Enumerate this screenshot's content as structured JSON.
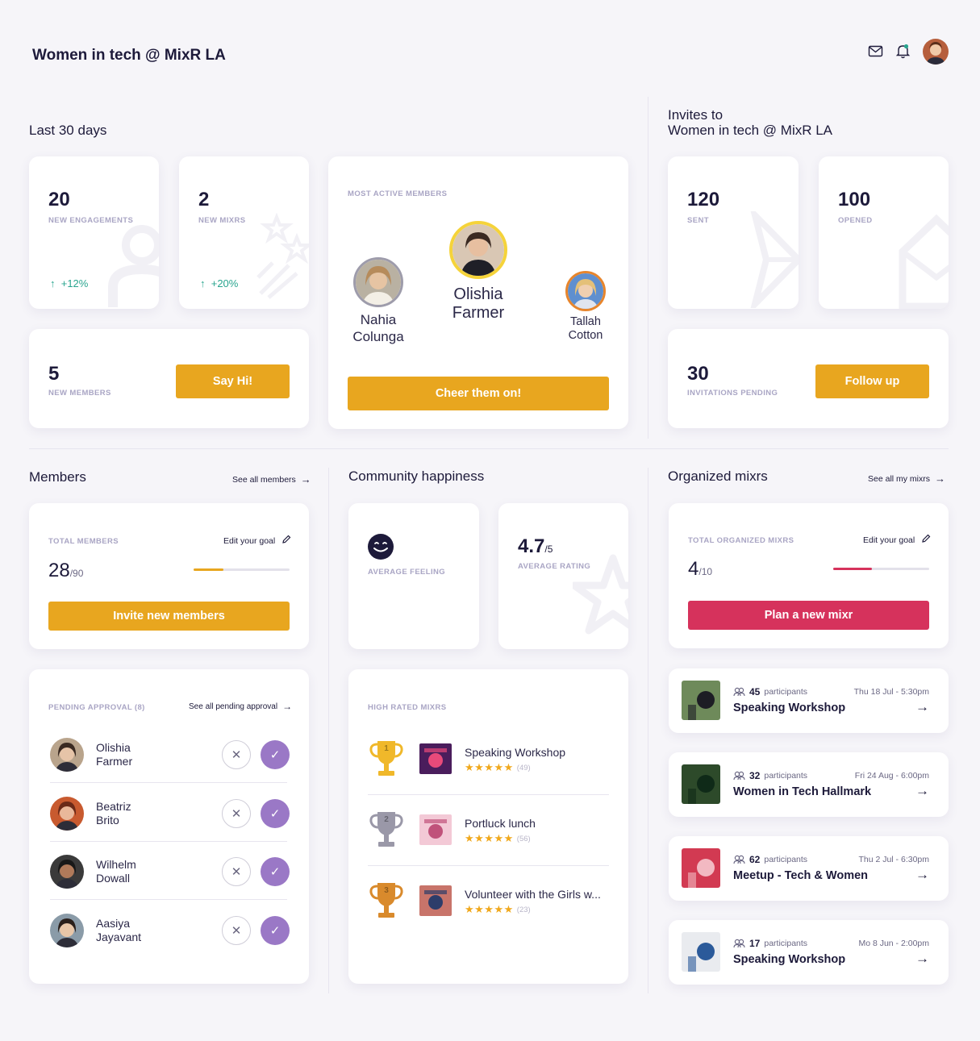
{
  "header": {
    "title": "Women in tech @ MixR LA"
  },
  "last30": {
    "title": "Last 30 days",
    "engagements": {
      "value": "20",
      "label": "NEW ENGAGEMENTS",
      "change": "+12%"
    },
    "mixrs": {
      "value": "2",
      "label": "NEW MIXRS",
      "change": "+20%"
    },
    "members": {
      "value": "5",
      "label": "NEW MEMBERS",
      "button": "Say Hi!"
    }
  },
  "active": {
    "label": "MOST ACTIVE MEMBERS",
    "first": {
      "name1": "Olishia",
      "name2": "Farmer"
    },
    "second": {
      "name1": "Nahia",
      "name2": "Colunga"
    },
    "third": {
      "name1": "Tallah",
      "name2": "Cotton"
    },
    "button": "Cheer them on!"
  },
  "invites": {
    "title1": "Invites to",
    "title2": "Women in tech @ MixR LA",
    "sent": {
      "value": "120",
      "label": "SENT"
    },
    "opened": {
      "value": "100",
      "label": "OPENED"
    },
    "pending": {
      "value": "30",
      "label": "INVITATIONS PENDING",
      "button": "Follow up"
    }
  },
  "members": {
    "title": "Members",
    "see_all": "See all members",
    "total_label": "TOTAL MEMBERS",
    "edit_goal": "Edit your goal",
    "value": "28",
    "goal": "/90",
    "progress": 0.31,
    "button": "Invite new members"
  },
  "pending": {
    "label": "PENDING APPROVAL (8)",
    "see_all": "See all pending approval",
    "people": [
      {
        "first": "Olishia",
        "last": "Farmer"
      },
      {
        "first": "Beatriz",
        "last": "Brito"
      },
      {
        "first": "Wilhelm",
        "last": "Dowall"
      },
      {
        "first": "Aasiya",
        "last": "Jayavant"
      }
    ]
  },
  "happiness": {
    "title": "Community happiness",
    "feeling_label": "AVERAGE FEELING",
    "rating_value": "4.7",
    "rating_max": "/5",
    "rating_label": "AVERAGE RATING"
  },
  "high_rated": {
    "label": "HIGH RATED MIXRS",
    "items": [
      {
        "rank": "1",
        "title": "Speaking Workshop",
        "count": "(49)"
      },
      {
        "rank": "2",
        "title": "Portluck lunch",
        "count": "(56)"
      },
      {
        "rank": "3",
        "title": "Volunteer with the Girls w...",
        "count": "(23)"
      }
    ],
    "stars": "★★★★★"
  },
  "organized": {
    "title": "Organized mixrs",
    "see_all": "See all my mixrs",
    "total_label": "TOTAL ORGANIZED MIXRS",
    "edit_goal": "Edit your goal",
    "value": "4",
    "goal": "/10",
    "progress": 0.4,
    "button": "Plan a new mixr",
    "participants_word": "participants",
    "events": [
      {
        "count": "45",
        "date": "Thu 18 Jul - 5:30pm",
        "title": "Speaking Workshop"
      },
      {
        "count": "32",
        "date": "Fri 24 Aug - 6:00pm",
        "title": "Women in Tech Hallmark"
      },
      {
        "count": "62",
        "date": "Thu 2 Jul - 6:30pm",
        "title": "Meetup - Tech & Women"
      },
      {
        "count": "17",
        "date": "Mo 8 Jun - 2:00pm",
        "title": "Speaking Workshop"
      }
    ]
  },
  "colors": {
    "gold": "#e8a61f",
    "red": "#d6325c",
    "purple": "#9a78c6",
    "green": "#2aa58f"
  }
}
